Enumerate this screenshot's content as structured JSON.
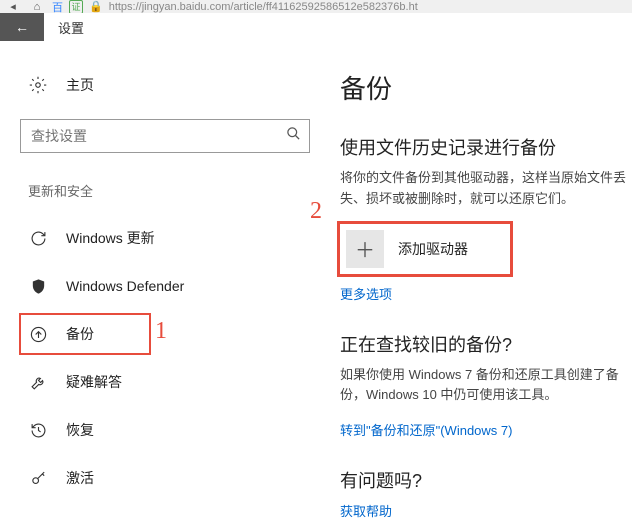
{
  "urlbar": {
    "baidu_text": "百",
    "badge_text": "证",
    "url": "https://jingyan.baidu.com/article/ff4116259258651​2e582376b.ht"
  },
  "header": {
    "back_glyph": "←",
    "title": "设置"
  },
  "sidebar": {
    "home_label": "主页",
    "search_placeholder": "查找设置",
    "section_label": "更新和安全",
    "items": [
      {
        "label": "Windows 更新"
      },
      {
        "label": "Windows Defender"
      },
      {
        "label": "备份"
      },
      {
        "label": "疑难解答"
      },
      {
        "label": "恢复"
      },
      {
        "label": "激活"
      }
    ]
  },
  "annotations": {
    "a1": "1",
    "a2": "2"
  },
  "main": {
    "title": "备份",
    "section1": {
      "heading": "使用文件历史记录进行备份",
      "body": "将你的文件备份到其他驱动器，这样当原始文件丢失、损坏或被删除时，就可以还原它们。",
      "add_label": "添加驱动器",
      "more": "更多选项"
    },
    "section2": {
      "heading": "正在查找较旧的备份?",
      "body": "如果你使用 Windows 7 备份和还原工具创建了备份，Windows 10 中仍可使用该工具。",
      "link": "转到\"备份和还原\"(Windows 7)"
    },
    "section3": {
      "heading": "有问题吗?",
      "link": "获取帮助"
    }
  }
}
